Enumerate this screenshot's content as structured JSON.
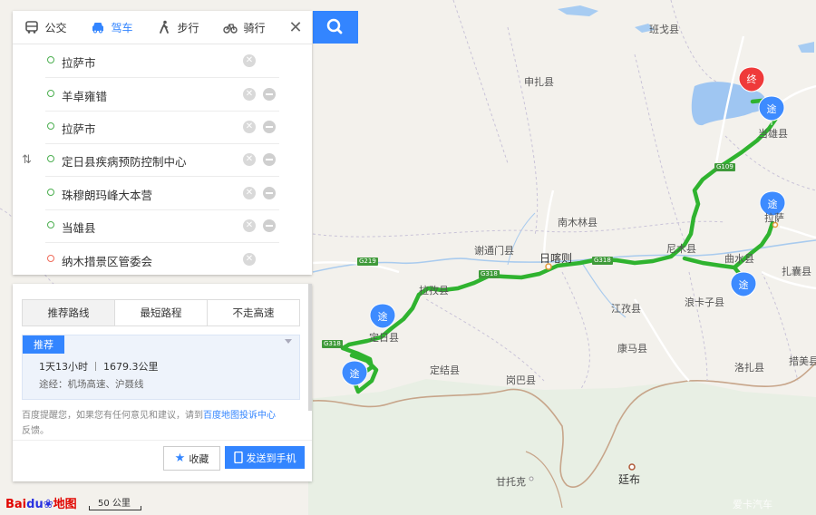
{
  "modes": [
    {
      "label": "公交",
      "icon": "bus-icon"
    },
    {
      "label": "驾车",
      "icon": "car-icon",
      "active": true
    },
    {
      "label": "步行",
      "icon": "walk-icon"
    },
    {
      "label": "骑行",
      "icon": "bike-icon"
    }
  ],
  "waypoints": [
    "拉萨市",
    "羊卓雍错",
    "拉萨市",
    "定日县疾病预防控制中心",
    "珠穆朗玛峰大本营",
    "当雄县",
    "纳木措景区管委会"
  ],
  "result": {
    "tabs": [
      "推荐路线",
      "最短路程",
      "不走高速"
    ],
    "plan_badge": "推荐",
    "duration": "1天13小时",
    "distance": "1679.3公里",
    "via": "途经：机场高速、沪聂线",
    "note_pre": "百度提醒您，如果您有任何意见和建议，请到",
    "note_link": "百度地图投诉中心",
    "note_post": "反馈。",
    "fav_label": "收藏",
    "send_label": "发送到手机"
  },
  "map": {
    "places": [
      "班戈县",
      "申扎县",
      "当雄县",
      "南木林县",
      "谢通门县",
      "日喀则",
      "尼木县",
      "拉萨",
      "曲水县",
      "浪卡子县",
      "扎囊县",
      "江孜县",
      "康马县",
      "洛扎县",
      "措美县",
      "定结县",
      "岗巴县",
      "定日县",
      "拉孜县",
      "甘托克",
      "廷布"
    ],
    "roads": [
      "G109",
      "G318",
      "G318",
      "G318",
      "G219"
    ],
    "pin_via": "途",
    "pin_end": "终",
    "scale": "50 公里",
    "logo_a": "Bai",
    "logo_b": "du",
    "logo_c": "地图",
    "watermark": "爱卡汽车"
  }
}
